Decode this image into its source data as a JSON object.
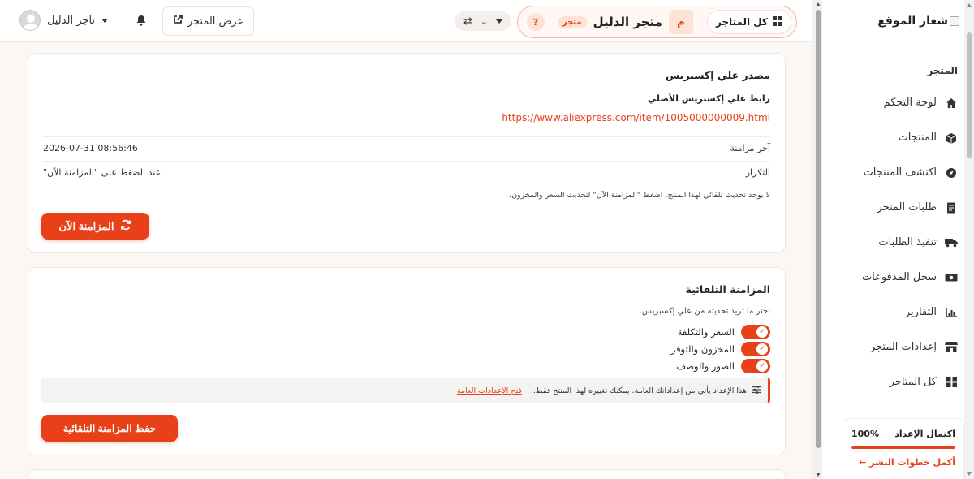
{
  "colors": {
    "accent": "#e8411a",
    "accent_soft": "#fde2d6",
    "background": "#fdf7f3"
  },
  "sidebar": {
    "logo_alt": "شعار الموقع",
    "section_label": "المتجر",
    "items": [
      {
        "label": "لوحة التحكم",
        "icon": "home-icon"
      },
      {
        "label": "المنتجات",
        "icon": "box-icon"
      },
      {
        "label": "اكتشف المنتجات",
        "icon": "compass-icon"
      },
      {
        "label": "طلبات المتجر",
        "icon": "receipt-icon"
      },
      {
        "label": "تنفيذ الطلبات",
        "icon": "truck-icon"
      },
      {
        "label": "سجل المدفوعات",
        "icon": "money-icon"
      },
      {
        "label": "التقارير",
        "icon": "chart-icon"
      },
      {
        "label": "إعدادات المتجر",
        "icon": "store-icon"
      },
      {
        "label": "كل المتاجر",
        "icon": "grid-icon"
      }
    ],
    "setup": {
      "title": "اكتمال الإعداد",
      "percent_label": "100%",
      "progress": 1.0,
      "link": "أكمل خطوات النشر ←"
    }
  },
  "header": {
    "all_stores": "كل المتاجر",
    "store_initial": "م",
    "store_name": "متجر الدليل",
    "store_badge": "متجر",
    "help": "?",
    "view_store": "عرض المتجر",
    "user_name": "تاجر الدليل"
  },
  "source_card": {
    "title": "مصدر علي إكسبريس",
    "link_label": "رابط علي إكسبريس الأصلي",
    "url": "https://www.aliexpress.com/item/1005000000009.html",
    "last_sync_label": "آخر مزامنة",
    "last_sync_value": "2026-07-31 08:56:46",
    "frequency_label": "التكرار",
    "frequency_value": "عند الضغط على \"المزامنة الآن\"",
    "note": "لا يوجد تحديث تلقائي لهذا المنتج. اضغط \"المزامنة الآن\" لتحديث السعر والمخزون.",
    "sync_button": "المزامنة الآن"
  },
  "auto_card": {
    "title": "المزامنة التلقائية",
    "choose_text": "اختر ما تريد تحديثه من علي إكسبريس.",
    "toggles": [
      {
        "label": "السعر والتكلفة",
        "on": true
      },
      {
        "label": "المخزون والتوفر",
        "on": true
      },
      {
        "label": "الصور والوصف",
        "on": true
      }
    ],
    "notice_text": "هذا الإعداد يأتي من إعداداتك العامة. يمكنك تغييره لهذا المنتج فقط.",
    "notice_link": "فتح الإعدادات العامة",
    "save_button": "حفظ المزامنة التلقائية"
  }
}
